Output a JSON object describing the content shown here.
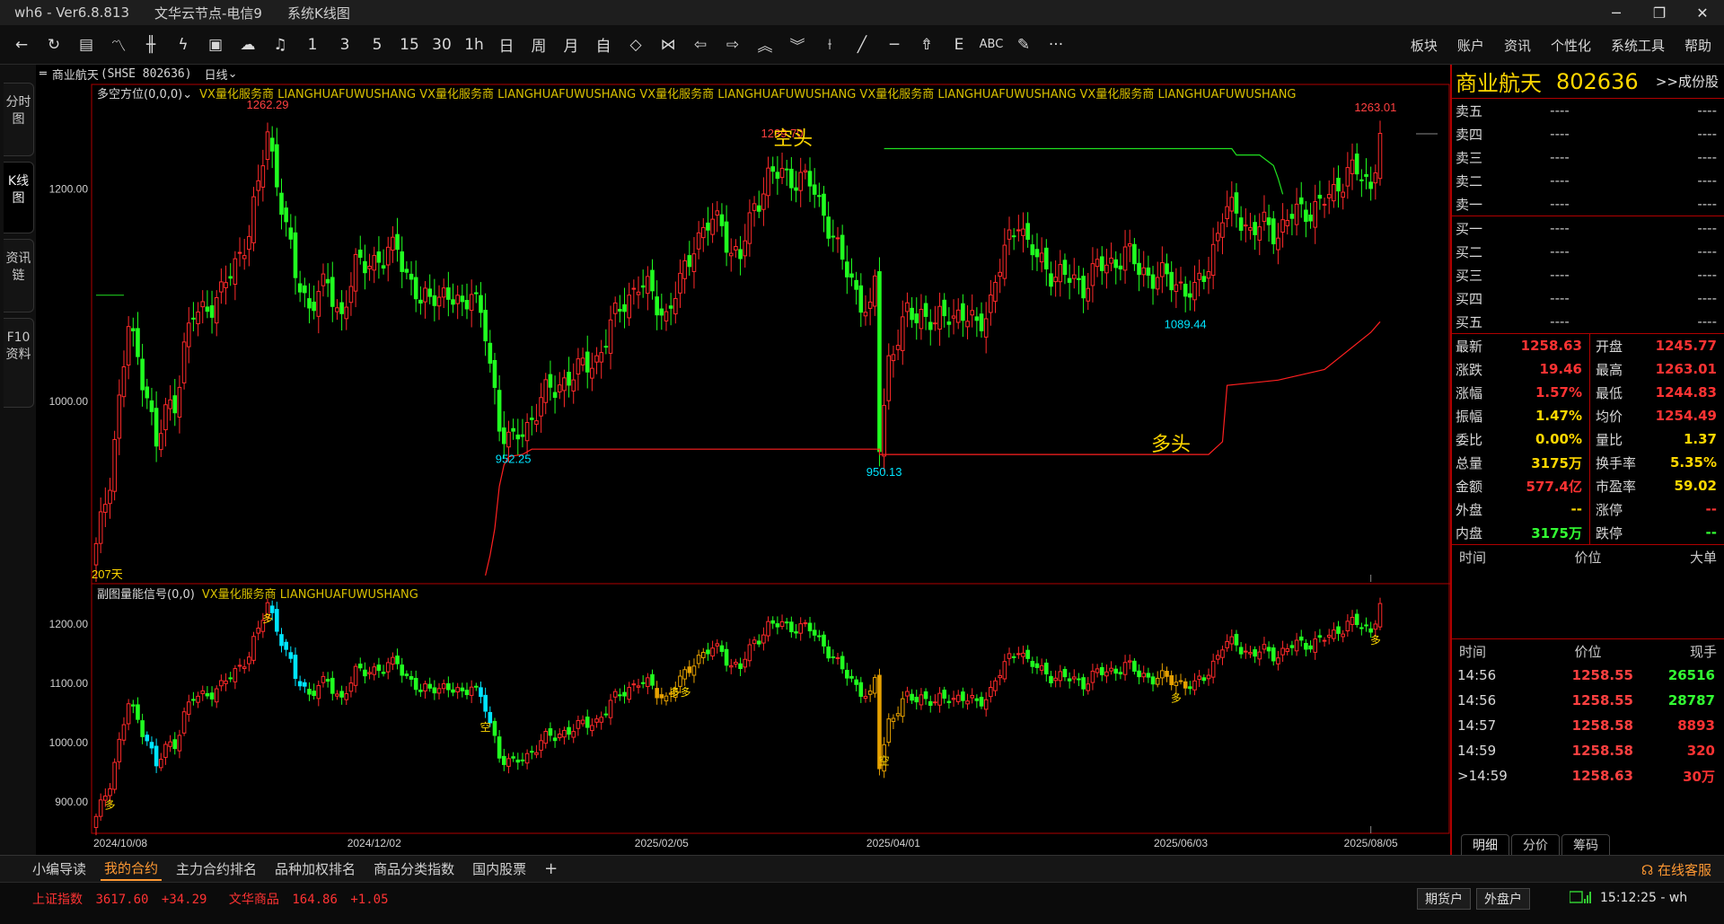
{
  "titlebar": {
    "app": "wh6  -  Ver6.8.813",
    "server": "文华云节点-电信9",
    "view": "系统K线图"
  },
  "toolbar": {
    "periods": [
      "1",
      "3",
      "5",
      "15",
      "30",
      "1h",
      "日",
      "周",
      "月",
      "自"
    ],
    "menu": [
      "板块",
      "账户",
      "资讯",
      "个性化",
      "系统工具",
      "帮助"
    ]
  },
  "lefttabs": [
    "分时图",
    "K线图",
    "资讯链",
    "F10资料"
  ],
  "chart_header": {
    "name": "商业航天",
    "code": "(SHSE 802636)",
    "period": "日线"
  },
  "main_indicator": {
    "name": "多空方位(0,0,0)",
    "ad": "VX量化服务商  LIANGHUAFUWUSHANG  VX量化服务商  LIANGHUAFUWUSHANG  VX量化服务商  LIANGHUAFUWUSHANG  VX量化服务商  LIANGHUAFUWUSHANG  VX量化服务商  LIANGHUAFUWUSHANG"
  },
  "sub_indicator": {
    "name": "副图量能信号(0,0)",
    "ad": "VX量化服务商  LIANGHUAFUWUSHANG"
  },
  "chart_data": [
    {
      "type": "candlestick",
      "title": "多空方位(0,0,0)",
      "ylim": [
        830,
        1290
      ],
      "yticks": [
        "1200.00",
        "1000.00"
      ],
      "annotations": {
        "high1": "1262.29",
        "high2": "1239.70",
        "high3": "1263.01",
        "low1": "952.25",
        "low2": "950.13",
        "low3": "1089.44",
        "bear_label": "空头",
        "bull_label": "多头",
        "days": "207天"
      },
      "keypoints": [
        [
          0,
          860
        ],
        [
          3,
          930
        ],
        [
          5,
          1000
        ],
        [
          7,
          1070
        ],
        [
          9,
          1040
        ],
        [
          11,
          1010
        ],
        [
          13,
          955
        ],
        [
          15,
          990
        ],
        [
          17,
          1000
        ],
        [
          19,
          1050
        ],
        [
          21,
          1080
        ],
        [
          24,
          1090
        ],
        [
          27,
          1100
        ],
        [
          30,
          1130
        ],
        [
          33,
          1160
        ],
        [
          35,
          1200
        ],
        [
          37,
          1255
        ],
        [
          39,
          1210
        ],
        [
          41,
          1160
        ],
        [
          43,
          1120
        ],
        [
          46,
          1090
        ],
        [
          50,
          1110
        ],
        [
          53,
          1080
        ],
        [
          56,
          1125
        ],
        [
          59,
          1135
        ],
        [
          62,
          1130
        ],
        [
          65,
          1150
        ],
        [
          67,
          1120
        ],
        [
          70,
          1090
        ],
        [
          73,
          1105
        ],
        [
          76,
          1095
        ],
        [
          79,
          1090
        ],
        [
          81,
          1110
        ],
        [
          84,
          1060
        ],
        [
          87,
          980
        ],
        [
          90,
          960
        ],
        [
          93,
          975
        ],
        [
          96,
          1005
        ],
        [
          99,
          1010
        ],
        [
          102,
          1025
        ],
        [
          105,
          1030
        ],
        [
          108,
          1040
        ],
        [
          111,
          1070
        ],
        [
          114,
          1095
        ],
        [
          117,
          1110
        ],
        [
          120,
          1100
        ],
        [
          123,
          1080
        ],
        [
          126,
          1110
        ],
        [
          129,
          1150
        ],
        [
          132,
          1165
        ],
        [
          135,
          1170
        ],
        [
          137,
          1140
        ],
        [
          139,
          1135
        ],
        [
          142,
          1185
        ],
        [
          145,
          1210
        ],
        [
          148,
          1215
        ],
        [
          151,
          1210
        ],
        [
          154,
          1205
        ],
        [
          157,
          1180
        ],
        [
          160,
          1140
        ],
        [
          163,
          1115
        ],
        [
          165,
          1095
        ],
        [
          167,
          1080
        ],
        [
          168,
          1110
        ],
        [
          169,
          960
        ],
        [
          171,
          1040
        ],
        [
          173,
          1060
        ],
        [
          175,
          1080
        ],
        [
          178,
          1085
        ],
        [
          181,
          1070
        ],
        [
          184,
          1085
        ],
        [
          187,
          1080
        ],
        [
          190,
          1070
        ],
        [
          193,
          1095
        ],
        [
          196,
          1140
        ],
        [
          199,
          1175
        ],
        [
          201,
          1145
        ],
        [
          204,
          1130
        ],
        [
          207,
          1120
        ],
        [
          210,
          1115
        ],
        [
          213,
          1110
        ],
        [
          216,
          1125
        ],
        [
          219,
          1130
        ],
        [
          222,
          1140
        ],
        [
          225,
          1125
        ],
        [
          228,
          1118
        ],
        [
          231,
          1115
        ],
        [
          234,
          1110
        ],
        [
          237,
          1100
        ],
        [
          240,
          1130
        ],
        [
          243,
          1175
        ],
        [
          246,
          1180
        ],
        [
          249,
          1160
        ],
        [
          252,
          1165
        ],
        [
          255,
          1160
        ],
        [
          258,
          1175
        ],
        [
          261,
          1180
        ],
        [
          264,
          1185
        ],
        [
          267,
          1195
        ],
        [
          270,
          1220
        ],
        [
          273,
          1210
        ],
        [
          275,
          1200
        ],
        [
          277,
          1258
        ]
      ]
    },
    {
      "type": "candlestick",
      "title": "副图量能信号(0,0)",
      "ylim": [
        850,
        1250
      ],
      "yticks": [
        "1200.00",
        "1100.00",
        "1000.00",
        "900.00"
      ],
      "signals": [
        {
          "i": 3,
          "text": "多"
        },
        {
          "i": 37,
          "text": "多"
        },
        {
          "i": 84,
          "text": "空"
        },
        {
          "i": 126,
          "text": "多多"
        },
        {
          "i": 170,
          "text": "空"
        },
        {
          "i": 233,
          "text": "多"
        },
        {
          "i": 276,
          "text": "多"
        }
      ]
    }
  ],
  "xaxis": {
    "labels": [
      "2024/10/08",
      "2024/12/02",
      "2025/02/05",
      "2025/04/01",
      "2025/06/03",
      "2025/08/05"
    ]
  },
  "quote": {
    "name": "商业航天",
    "code": "802636",
    "compose": ">>成份股",
    "asks": [
      {
        "l": "卖五",
        "p": "----",
        "v": "----"
      },
      {
        "l": "卖四",
        "p": "----",
        "v": "----"
      },
      {
        "l": "卖三",
        "p": "----",
        "v": "----"
      },
      {
        "l": "卖二",
        "p": "----",
        "v": "----"
      },
      {
        "l": "卖一",
        "p": "----",
        "v": "----"
      }
    ],
    "bids": [
      {
        "l": "买一",
        "p": "----",
        "v": "----"
      },
      {
        "l": "买二",
        "p": "----",
        "v": "----"
      },
      {
        "l": "买三",
        "p": "----",
        "v": "----"
      },
      {
        "l": "买四",
        "p": "----",
        "v": "----"
      },
      {
        "l": "买五",
        "p": "----",
        "v": "----"
      }
    ],
    "stats": [
      {
        "k": "最新",
        "v": "1258.63",
        "c": "#ff3333",
        "k2": "开盘",
        "v2": "1245.77",
        "c2": "#ff3333"
      },
      {
        "k": "涨跌",
        "v": "19.46",
        "c": "#ff3333",
        "k2": "最高",
        "v2": "1263.01",
        "c2": "#ff3333"
      },
      {
        "k": "涨幅",
        "v": "1.57%",
        "c": "#ff3333",
        "k2": "最低",
        "v2": "1244.83",
        "c2": "#ff3333"
      },
      {
        "k": "振幅",
        "v": "1.47%",
        "c": "#ffd700",
        "k2": "均价",
        "v2": "1254.49",
        "c2": "#ff3333"
      },
      {
        "k": "委比",
        "v": "0.00%",
        "c": "#ffd700",
        "k2": "量比",
        "v2": "1.37",
        "c2": "#ffd700"
      },
      {
        "k": "总量",
        "v": "3175万",
        "c": "#ffd700",
        "k2": "换手率",
        "v2": "5.35%",
        "c2": "#ffd700"
      },
      {
        "k": "金额",
        "v": "577.4亿",
        "c": "#ff3333",
        "k2": "市盈率",
        "v2": "59.02",
        "c2": "#ffd700"
      },
      {
        "k": "外盘",
        "v": "--",
        "c": "#ffd700",
        "k2": "涨停",
        "v2": "--",
        "c2": "#ff3333"
      },
      {
        "k": "内盘",
        "v": "3175万",
        "c": "#33ff33",
        "k2": "跌停",
        "v2": "--",
        "c2": "#33ff33"
      }
    ],
    "big_header": [
      "时间",
      "价位",
      "大单"
    ],
    "tick_header": [
      "时间",
      "价位",
      "现手"
    ],
    "ticks": [
      {
        "t": "14:56",
        "p": "1258.55",
        "v": "26516",
        "c": "#33ff33"
      },
      {
        "t": "14:56",
        "p": "1258.55",
        "v": "28787",
        "c": "#33ff33"
      },
      {
        "t": "14:57",
        "p": "1258.58",
        "v": "8893",
        "c": "#ff3333"
      },
      {
        "t": "14:59",
        "p": "1258.58",
        "v": "320",
        "c": "#ff3333"
      },
      {
        "t": ">14:59",
        "p": "1258.63",
        "v": "30万",
        "c": "#ff3333"
      }
    ],
    "subtabs": [
      "明细",
      "分价",
      "筹码"
    ]
  },
  "bottom_tabs": [
    "小编导读",
    "我的合约",
    "主力合约排名",
    "品种加权排名",
    "商品分类指数",
    "国内股票"
  ],
  "service": "在线客服",
  "status": {
    "idx1_name": "上证指数",
    "idx1_val": "3617.60",
    "idx1_chg": "+34.29",
    "idx2_name": "文华商品",
    "idx2_val": "164.86",
    "idx2_chg": "+1.05",
    "btn1": "期货户",
    "btn2": "外盘户",
    "clock": "15:12:25 - wh"
  },
  "colors": {
    "up": "#ff2a2a",
    "down": "#20ff20",
    "cyan": "#00e5ff",
    "yellow": "#ffd700",
    "frame": "#b00000"
  }
}
